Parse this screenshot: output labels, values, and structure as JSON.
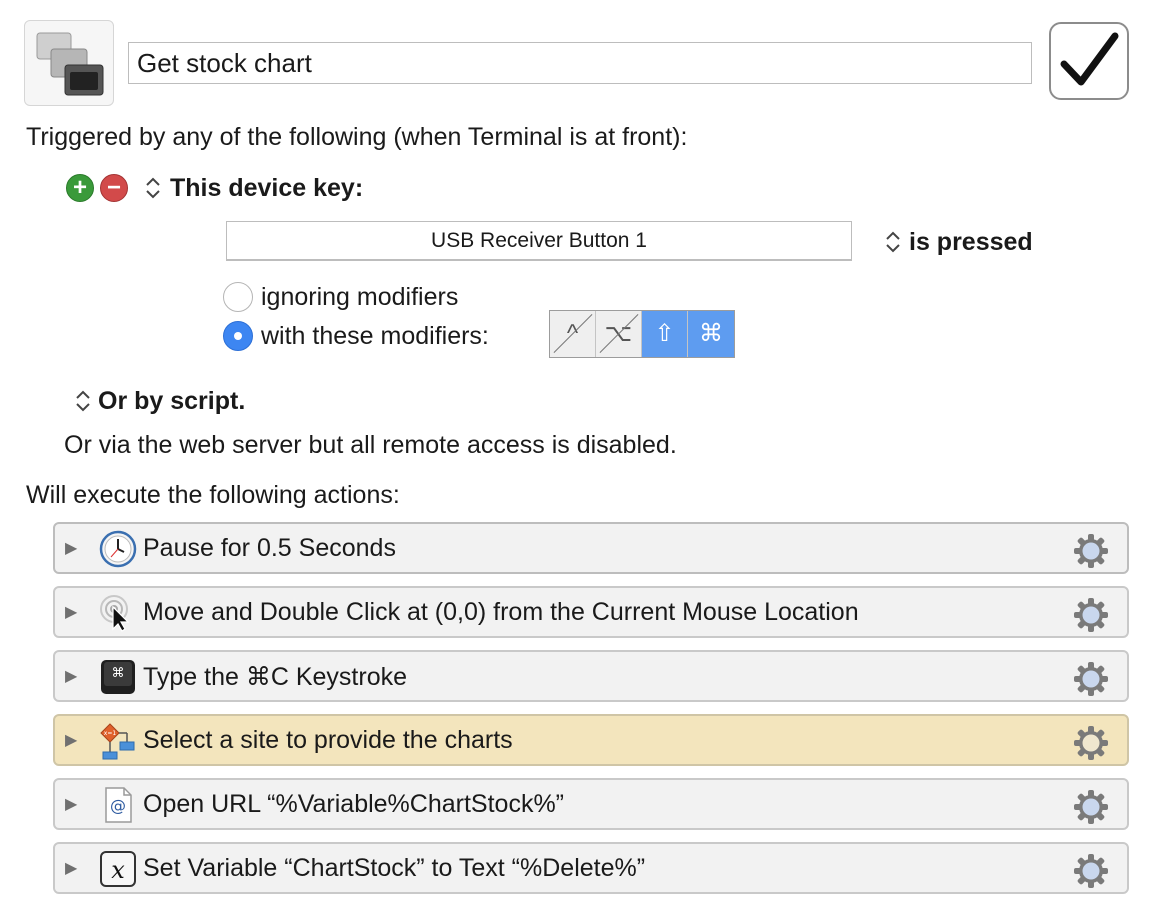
{
  "macro": {
    "title": "Get stock chart",
    "enabled": true
  },
  "trigger": {
    "heading": "Triggered by any of the following (when Terminal is at front):",
    "add_label": "+",
    "remove_label": "−",
    "type_label": "This device key:",
    "device_key": "USB Receiver Button 1",
    "state_label": "is pressed",
    "ignoring_label": "ignoring modifiers",
    "with_label": "with these modifiers:",
    "modifiers": [
      {
        "symbol": "^",
        "name": "control",
        "active": false
      },
      {
        "symbol": "⌥",
        "name": "option",
        "active": false
      },
      {
        "symbol": "⇧",
        "name": "shift",
        "active": true
      },
      {
        "symbol": "⌘",
        "name": "command",
        "active": true
      }
    ],
    "selected_mode": "with these modifiers",
    "script_label": "Or by script.",
    "web_label": "Or via the web server but all remote access is disabled."
  },
  "actions": {
    "heading": "Will execute the following actions:",
    "items": [
      {
        "label": "Pause for 0.5 Seconds",
        "icon": "clock-icon"
      },
      {
        "label": "Move and Double Click at (0,0) from the Current Mouse Location",
        "icon": "mouse-click-icon"
      },
      {
        "label": "Type the ⌘C Keystroke",
        "icon": "keystroke-icon"
      },
      {
        "label": "Select a site to provide the charts",
        "icon": "flowchart-icon"
      },
      {
        "label": "Open URL “%Variable%ChartStock%”",
        "icon": "url-document-icon"
      },
      {
        "label": "Set Variable “ChartStock” to Text “%Delete%”",
        "icon": "variable-icon"
      }
    ]
  },
  "colors": {
    "accent": "#3d86f2",
    "highlight_row": "#f3e5bd",
    "add_green": "#3a9a3a",
    "remove_red": "#d24a4a"
  }
}
